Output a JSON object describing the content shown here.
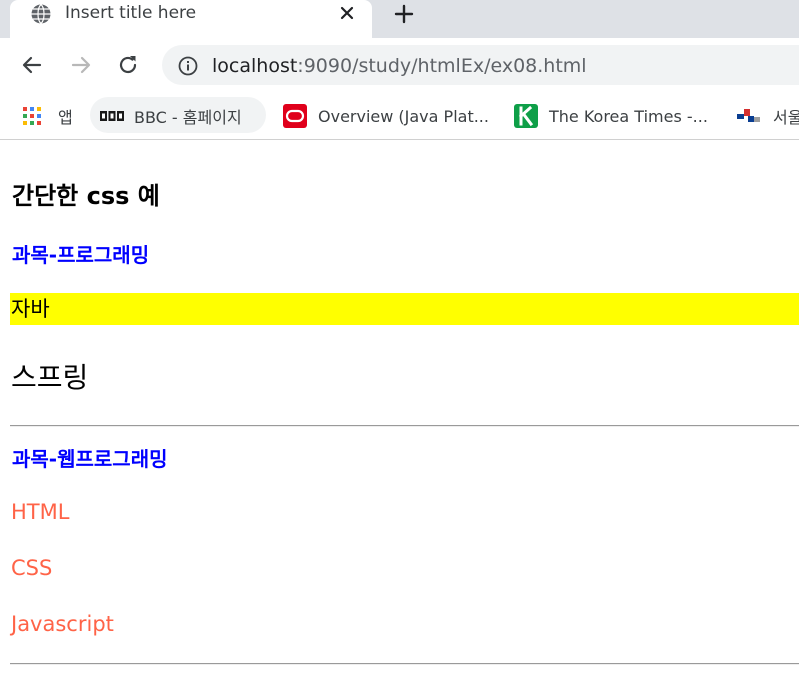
{
  "browser": {
    "tab": {
      "title": "Insert title here"
    },
    "address": {
      "host": "localhost",
      "path": ":9090/study/htmlEx/ex08.html"
    },
    "bookmarks": [
      {
        "label": "앱"
      },
      {
        "label": "BBC - 홈페이지"
      },
      {
        "label": "Overview (Java Plat..."
      },
      {
        "label": "The Korea Times -..."
      },
      {
        "label": "서울"
      }
    ]
  },
  "page": {
    "heading": "간단한 css 예",
    "section1": {
      "title": "과목-프로그래밍",
      "items": [
        "자바",
        "스프링"
      ]
    },
    "section2": {
      "title": "과목-웹프로그래밍",
      "items": [
        "HTML",
        "CSS",
        "Javascript"
      ]
    }
  },
  "colors": {
    "subject_title": "#0000ff",
    "highlight": "#ffff00",
    "web_item": "#ff6347",
    "tabstrip": "#dee1e6",
    "omnibox": "#f1f3f4"
  }
}
